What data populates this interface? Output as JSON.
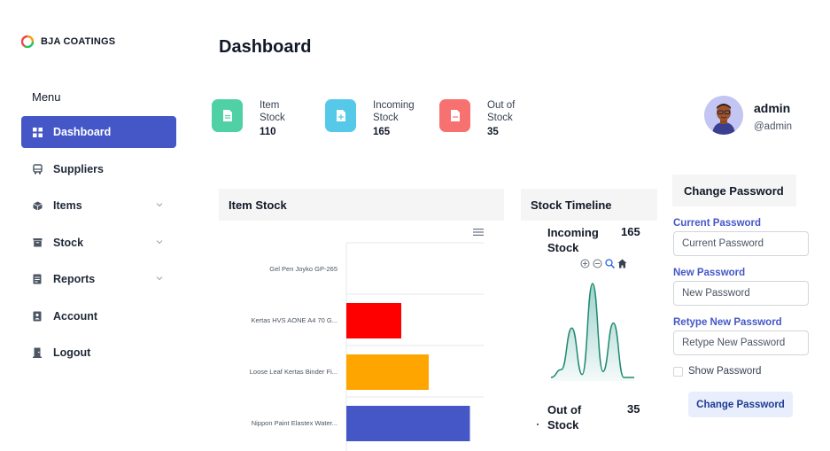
{
  "brand": {
    "name": "BJA COATINGS"
  },
  "sidebar": {
    "menu_heading": "Menu",
    "items": [
      {
        "label": "Dashboard",
        "icon": "grid-icon",
        "active": true,
        "has_submenu": false
      },
      {
        "label": "Suppliers",
        "icon": "bus-icon",
        "active": false,
        "has_submenu": false
      },
      {
        "label": "Items",
        "icon": "box-icon",
        "active": false,
        "has_submenu": true
      },
      {
        "label": "Stock",
        "icon": "archive-icon",
        "active": false,
        "has_submenu": true
      },
      {
        "label": "Reports",
        "icon": "report-icon",
        "active": false,
        "has_submenu": true
      },
      {
        "label": "Account",
        "icon": "contact-icon",
        "active": false,
        "has_submenu": false
      },
      {
        "label": "Logout",
        "icon": "logout-icon",
        "active": false,
        "has_submenu": false
      }
    ]
  },
  "header": {
    "title": "Dashboard"
  },
  "stats": [
    {
      "label": "Item Stock",
      "value": "110",
      "color": "#4fd1a5",
      "icon": "document-icon"
    },
    {
      "label": "Incoming Stock",
      "value": "165",
      "color": "#56c8e8",
      "icon": "document-add-icon"
    },
    {
      "label": "Out of Stock",
      "value": "35",
      "color": "#f87171",
      "icon": "document-remove-icon"
    }
  ],
  "profile": {
    "name": "admin",
    "handle": "@admin"
  },
  "item_stock": {
    "title": "Item Stock"
  },
  "timeline": {
    "title": "Stock Timeline",
    "incoming_label": "Incoming Stock",
    "incoming_value": "165",
    "out_label": "Out of Stock",
    "out_value": "35"
  },
  "password": {
    "title": "Change Password",
    "current_label": "Current Password",
    "current_placeholder": "Current Password",
    "new_label": "New Password",
    "new_placeholder": "New Password",
    "retype_label": "Retype New Password",
    "retype_placeholder": "Retype New Password",
    "show_label": "Show Password",
    "button_label": "Change Password"
  },
  "chart_data": [
    {
      "type": "bar",
      "orientation": "horizontal",
      "title": "",
      "categories": [
        "Gel Pen Joyko GP-265",
        "Kertas HVS AONE A4 70 G...",
        "Loose Leaf Kertas Binder Fi...",
        "Nippon Paint Elastex Water..."
      ],
      "values": [
        0,
        40,
        60,
        90
      ],
      "colors": [
        "#4557c7",
        "#ff0000",
        "#ffa500",
        "#4557c7"
      ],
      "xlim": [
        0,
        100
      ]
    },
    {
      "type": "area",
      "title": "",
      "x": [
        0,
        1,
        2,
        3,
        4,
        5,
        6,
        7,
        8
      ],
      "values": [
        0,
        8,
        50,
        3,
        95,
        6,
        55,
        0,
        0
      ],
      "color": "#2a9d8f"
    }
  ]
}
